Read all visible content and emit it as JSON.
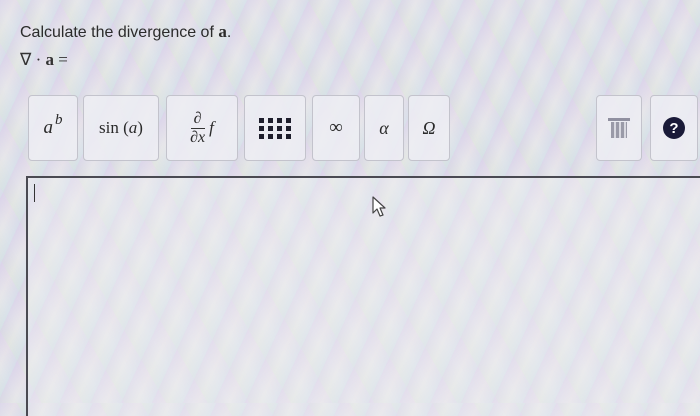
{
  "question": {
    "prefix": "Calculate the divergence of ",
    "vector": "a",
    "suffix": "."
  },
  "equation": {
    "operator": "∇ · ",
    "vector": "a",
    "equals": " ="
  },
  "toolbar": {
    "power": {
      "base": "a",
      "exponent": "b"
    },
    "function": {
      "name": "sin",
      "arg": "a"
    },
    "derivative": {
      "numerator": "∂",
      "denominator": "∂x",
      "func": "f"
    },
    "infinity": "∞",
    "alpha": "α",
    "omega": "Ω",
    "help": "?"
  }
}
